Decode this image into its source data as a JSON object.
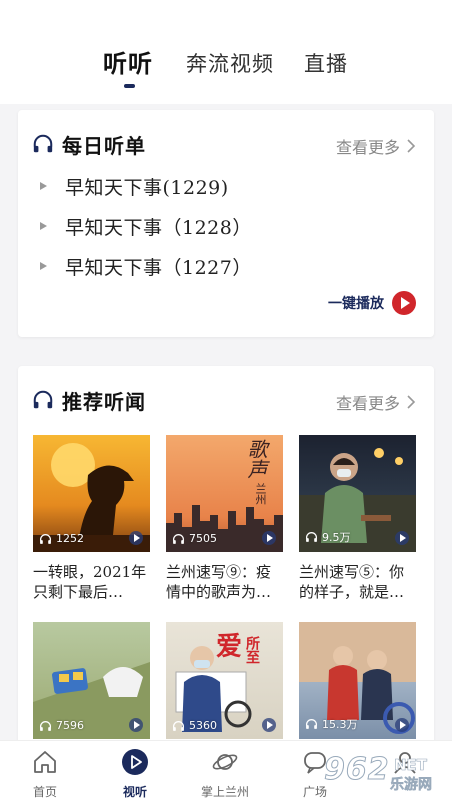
{
  "tabs": [
    {
      "label": "听听",
      "active": true
    },
    {
      "label": "奔流视频",
      "active": false
    },
    {
      "label": "直播",
      "active": false
    }
  ],
  "daily": {
    "title": "每日听单",
    "more": "查看更多",
    "items": [
      "早知天下事(1229)",
      "早知天下事（1228）",
      "早知天下事（1227）"
    ],
    "play_all": "一键播放"
  },
  "recommend": {
    "title": "推荐听闻",
    "more": "查看更多",
    "items": [
      {
        "count": "1252",
        "title": "一转眼，2021年只剩下最后…"
      },
      {
        "count": "7505",
        "title": "兰州速写⑨：疫情中的歌声为…"
      },
      {
        "count": "9.5万",
        "title": "兰州速写⑤：你的样子，就是…"
      },
      {
        "count": "7596",
        "title": ""
      },
      {
        "count": "5360",
        "title": ""
      },
      {
        "count": "15.3万",
        "title": ""
      }
    ]
  },
  "bottom_nav": [
    {
      "label": "首页",
      "icon": "home-icon",
      "active": false
    },
    {
      "label": "视听",
      "icon": "play-icon",
      "active": true
    },
    {
      "label": "掌上兰州",
      "icon": "planet-icon",
      "active": false
    },
    {
      "label": "广场",
      "icon": "chat-icon",
      "active": false
    },
    {
      "label": "",
      "icon": "user-icon",
      "active": false
    }
  ],
  "watermark": {
    "number": "962",
    "net": "NET",
    "text": "乐游网"
  },
  "thumb_texts": {
    "t2_vertical": "歌声",
    "t2_vertical2": "兰州",
    "t5_big": "爱",
    "t5_side": "所至"
  },
  "colors": {
    "accent": "#1b2a5c",
    "play_red": "#d0262b"
  }
}
